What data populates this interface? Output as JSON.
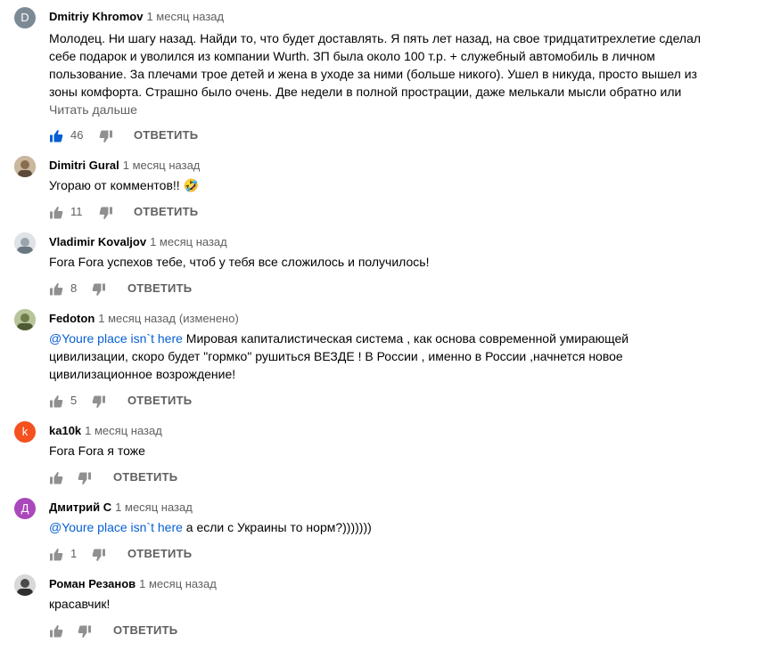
{
  "colors": {
    "like_active": "#065fd4",
    "icon": "#909090",
    "mention": "#065fd4"
  },
  "comments": [
    {
      "author": "Dmitriy Khromov",
      "time": "1 месяц назад",
      "avatar_letter": "D",
      "avatar_color": "#7c8a96",
      "text": "Молодец. Ни шагу назад. Найди то, что будет доставлять. Я пять лет назад, на свое тридцатитрехлетие сделал себе подарок и уволился из компании Wurth. ЗП была около 100 т.р. + служебный автомобиль в личном пользование. За плечами трое детей и жена в уходе за ними (больше никого). Ушел в никуда, просто вышел из зоны комфорта. Страшно было очень. Две недели в полной прострации, даже мелькали мысли обратно или",
      "read_more": "Читать дальше",
      "likes": "46",
      "reply": "ОТВЕТИТЬ"
    },
    {
      "author": "Dimitri Gural",
      "time": "1 месяц назад",
      "avatar_icon": "avatar-photo",
      "text": "Угораю от комментов!! 🤣",
      "likes": "11",
      "reply": "ОТВЕТИТЬ"
    },
    {
      "author": "Vladimir Kovaljov",
      "time": "1 месяц назад",
      "avatar_icon": "avatar-photo",
      "text": "Fora Fora успехов тебе, чтоб у тебя все сложилось и получилось!",
      "likes": "8",
      "reply": "ОТВЕТИТЬ"
    },
    {
      "author": "Fedoton",
      "time": "1 месяц назад",
      "edited": "(изменено)",
      "avatar_icon": "avatar-photo",
      "mention": "@Youre place isn`t here",
      "text": " Мировая капиталистическая система , как основа современной  умирающей цивилизации, скоро будет \"гормко\"  рушиться ВЕЗДЕ ! В России  , именно в России ,начнется новое цивилизационное возрождение!",
      "likes": "5",
      "reply": "ОТВЕТИТЬ"
    },
    {
      "author": "ka10k",
      "time": "1 месяц назад",
      "avatar_letter": "k",
      "avatar_color": "#f4511e",
      "text": "Fora Fora я тоже",
      "likes": "",
      "reply": "ОТВЕТИТЬ"
    },
    {
      "author": "Дмитрий С",
      "time": "1 месяц назад",
      "avatar_letter": "Д",
      "avatar_color": "#ab47bc",
      "mention": "@Youre place isn`t here",
      "text": " а если с Украины то норм?)))))))",
      "likes": "1",
      "reply": "ОТВЕТИТЬ"
    },
    {
      "author": "Роман Резанов",
      "time": "1 месяц назад",
      "avatar_icon": "avatar-photo",
      "text": "красавчик!",
      "likes": "",
      "reply": "ОТВЕТИТЬ"
    }
  ]
}
